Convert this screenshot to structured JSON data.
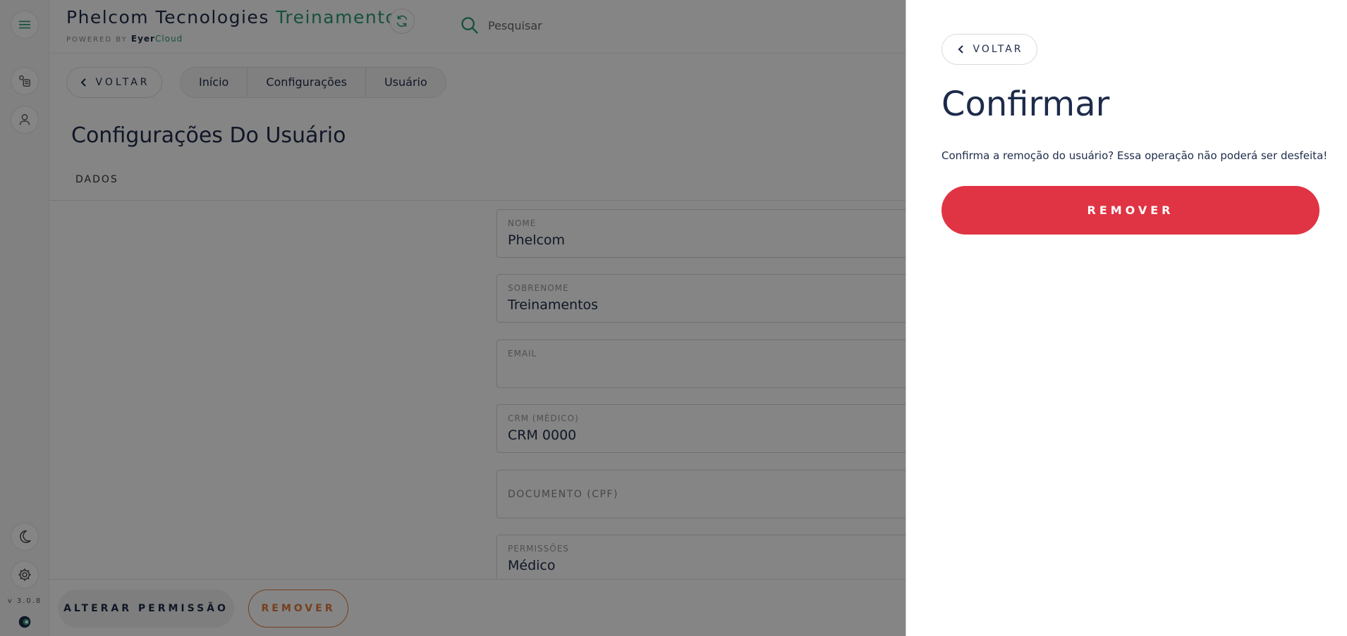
{
  "rail": {
    "version": "v 3.0.8"
  },
  "header": {
    "brand_name": "Phelcom Tecnologies",
    "brand_accent": "Treinamentos",
    "powered_by": "POWERED BY",
    "powered_brand": "Eyer",
    "powered_brand_accent": "Cloud",
    "search_placeholder": "Pesquisar"
  },
  "nav": {
    "back_label": "VOLTAR",
    "breadcrumbs": [
      "Início",
      "Configurações",
      "Usuário"
    ]
  },
  "page": {
    "title": "Configurações Do Usuário",
    "tab": "DADOS"
  },
  "fields": [
    {
      "label": "NOME",
      "value": "Phelcom"
    },
    {
      "label": "SOBRENOME",
      "value": "Treinamentos"
    },
    {
      "label": "EMAIL",
      "value": ""
    },
    {
      "label": "CRM (MÉDICO)",
      "value": "CRM 0000"
    },
    {
      "label": "DOCUMENTO (CPF)",
      "value": ""
    },
    {
      "label": "PERMISSÕES",
      "value": "Médico"
    }
  ],
  "footer": {
    "change_permission_label": "ALTERAR PERMISSÃO",
    "remove_label": "REMOVER"
  },
  "panel": {
    "back_label": "VOLTAR",
    "title": "Confirmar",
    "message": "Confirma a remoção do usuário? Essa operação não poderá ser desfeita!",
    "remove_label": "REMOVER"
  },
  "colors": {
    "brand_navy": "#1d2b4a",
    "brand_green": "#2b9a7a",
    "danger": "#e03444",
    "warning": "#e07a3a"
  },
  "icons": {
    "menu": "menu-icon",
    "exams": "exam-list-icon",
    "patients": "patient-icon",
    "dark_mode": "moon-icon",
    "settings": "gear-icon",
    "logo": "eyer-logo-icon",
    "sync": "sync-icon",
    "search": "search-icon",
    "back": "chevron-left-icon"
  }
}
